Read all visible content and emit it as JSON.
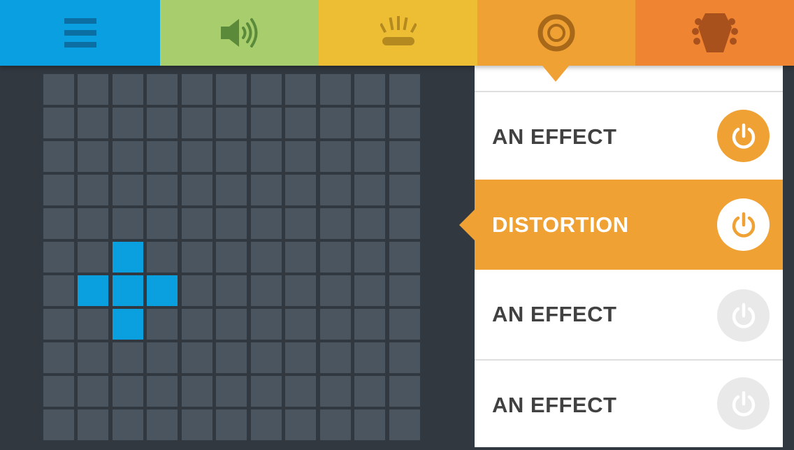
{
  "tabs": [
    {
      "id": "menu",
      "icon": "hamburger-menu-icon",
      "color": "#0a9fe0",
      "icon_color": "#0b6fa3"
    },
    {
      "id": "volume",
      "icon": "speaker-volume-icon",
      "color": "#a8cd6d",
      "icon_color": "#5a8a3a"
    },
    {
      "id": "lights",
      "icon": "light-flash-icon",
      "color": "#edbd34",
      "icon_color": "#b48a20"
    },
    {
      "id": "effects",
      "icon": "target-circle-icon",
      "color": "#f0a134",
      "icon_color": "#a8681a"
    },
    {
      "id": "guitar",
      "icon": "guitar-headstock-icon",
      "color": "#ef8433",
      "icon_color": "#a9511d"
    }
  ],
  "grid": {
    "rows": 11,
    "cols": 11,
    "active_cells": [
      [
        5,
        2
      ],
      [
        6,
        1
      ],
      [
        6,
        2
      ],
      [
        6,
        3
      ],
      [
        7,
        2
      ]
    ],
    "cell_color": "#4a5560",
    "active_color": "#0aa0e0"
  },
  "effects": [
    {
      "label": "AN EFFECT",
      "active": false,
      "power_state": "on"
    },
    {
      "label": "DISTORTION",
      "active": true,
      "power_state": "on"
    },
    {
      "label": "AN EFFECT",
      "active": false,
      "power_state": "off"
    },
    {
      "label": "AN EFFECT",
      "active": false,
      "power_state": "off"
    }
  ],
  "colors": {
    "accent": "#f0a134",
    "background": "#323840",
    "power_off": "#e9e9e9"
  }
}
